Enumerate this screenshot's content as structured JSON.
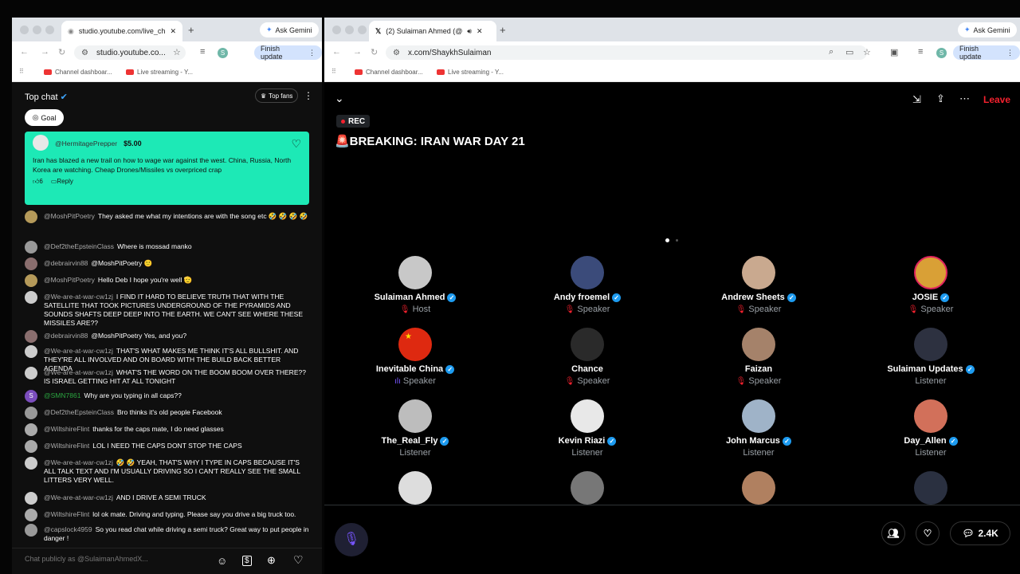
{
  "left": {
    "tab_title": "studio.youtube.com/live_chat",
    "gemini": "Ask Gemini",
    "url": "studio.youtube.co...",
    "profile": "S",
    "finish": "Finish update",
    "bookmarks": [
      "Channel dashboar...",
      "Live streaming - Y..."
    ],
    "chat_title": "Top chat",
    "top_fans": "Top fans",
    "goal": "Goal",
    "superchat": {
      "author": "@HermitagePrepper",
      "amount": "$5.00",
      "text": "Iran has blazed a new trail on how to wage war against the west. China, Russia, North Korea are watching. Cheap Drones/Missiles vs overpriced crap",
      "likes": "6",
      "reply": "Reply"
    },
    "messages": [
      {
        "author": "@MoshPitPoetry",
        "text": "They asked me what my intentions are with the song etc 🤣 🤣 🤣 🤣"
      },
      {
        "author": "@Def2theEpsteinClass",
        "text": "Where is mossad manko"
      },
      {
        "author": "@debrairvin88",
        "text": "@MoshPitPoetry 🙂"
      },
      {
        "author": "@MoshPitPoetry",
        "text": "Hello Deb I hope you're well 🫡"
      },
      {
        "author": "@We-are-at-war-cw1zj",
        "text": "I FIND IT HARD TO BELIEVE TRUTH THAT WITH THE SATELLITE THAT TOOK PICTURES UNDERGROUND OF THE PYRAMIDS AND SOUNDS SHAFTS DEEP DEEP INTO THE EARTH. WE CAN'T SEE WHERE THESE MISSILES ARE??"
      },
      {
        "author": "@debrairvin88",
        "text": "@MoshPitPoetry Yes, and you?"
      },
      {
        "author": "@We-are-at-war-cw1zj",
        "text": "THAT'S WHAT MAKES ME THINK IT'S ALL BULLSHIT. AND THEY'RE ALL INVOLVED AND ON BOARD WITH THE BUILD BACK BETTER AGENDA"
      },
      {
        "author": "@We-are-at-war-cw1zj",
        "text": "WHAT'S THE WORD ON THE BOOM BOOM OVER THERE?? IS ISRAEL GETTING HIT AT ALL TONIGHT"
      },
      {
        "author": "@SMN7861",
        "text": "Why are you typing in all caps??"
      },
      {
        "author": "@Def2theEpsteinClass",
        "text": "Bro thinks it's old people Facebook"
      },
      {
        "author": "@WiltshireFlint",
        "text": "thanks for the caps mate, I do need glasses"
      },
      {
        "author": "@WiltshireFlint",
        "text": "LOL I NEED THE CAPS DONT STOP THE CAPS"
      },
      {
        "author": "@We-are-at-war-cw1zj",
        "text": "🤣 🤣 YEAH, THAT'S WHY I TYPE IN CAPS BECAUSE IT'S ALL TALK TEXT AND I'M USUALLY DRIVING SO I CAN'T REALLY SEE THE SMALL LITTERS VERY WELL."
      },
      {
        "author": "@We-are-at-war-cw1zj",
        "text": "AND I DRIVE A SEMI TRUCK"
      },
      {
        "author": "@WiltshireFlint",
        "text": "lol ok mate. Driving and typing. Please say you drive a big truck too."
      },
      {
        "author": "@capslock4959",
        "text": "So you read chat while driving a semi truck? Great way to put people in danger !"
      }
    ],
    "chat_placeholder": "Chat publicly as @SulaimanAhmedX..."
  },
  "right": {
    "tab_title": "(2) Sulaiman Ahmed (@Sh...",
    "gemini": "Ask Gemini",
    "url": "x.com/ShaykhSulaiman",
    "profile": "S",
    "finish": "Finish update",
    "bookmarks": [
      "Channel dashboar...",
      "Live streaming - Y..."
    ],
    "leave": "Leave",
    "rec": "REC",
    "title": "🚨BREAKING: IRAN WAR DAY 21",
    "participants": [
      {
        "name": "Sulaiman Ahmed",
        "role": "Host",
        "muted": true
      },
      {
        "name": "Andy froemel",
        "role": "Speaker",
        "muted": true
      },
      {
        "name": "Andrew Sheets",
        "role": "Speaker",
        "muted": true
      },
      {
        "name": "JOSIE",
        "role": "Speaker",
        "muted": true
      },
      {
        "name": "Inevitable China",
        "role": "Speaker",
        "muted": false
      },
      {
        "name": "Chance",
        "role": "Speaker",
        "muted": true
      },
      {
        "name": "Faizan",
        "role": "Speaker",
        "muted": true
      },
      {
        "name": "Sulaiman Updates",
        "role": "Listener",
        "muted": false
      },
      {
        "name": "The_Real_Fly",
        "role": "Listener",
        "muted": false
      },
      {
        "name": "Kevin Riazi",
        "role": "Listener",
        "muted": false
      },
      {
        "name": "John Marcus",
        "role": "Listener",
        "muted": false
      },
      {
        "name": "Day_Allen",
        "role": "Listener",
        "muted": false
      }
    ],
    "comment_count": "2.4K"
  }
}
